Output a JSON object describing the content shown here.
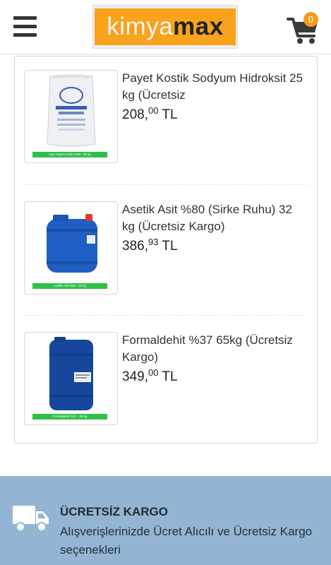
{
  "header": {
    "menu_icon": "hamburger-menu-icon",
    "logo_part1": "kimya",
    "logo_part2": "max",
    "cart_icon": "shopping-cart-icon",
    "cart_count": "0"
  },
  "products": [
    {
      "name": "Payet Kostik Sodyum Hidroksit 25 kg (Ücretsiz",
      "price_int": "208,",
      "price_dec": "00",
      "currency": " TL",
      "image_label": "Caustic soda flakes bag",
      "image_band": "Can Payet Kostik %99 - 25 kg"
    },
    {
      "name": "Asetik Asit %80 (Sirke Ruhu) 32 kg (Ücretsiz Kargo)",
      "price_int": "386,",
      "price_dec": "93",
      "currency": " TL",
      "image_label": "Blue drum with red cap",
      "image_band": "Asetik Asit %80 - 32 kg"
    },
    {
      "name": "Formaldehit %37 65kg (Ücretsiz Kargo)",
      "price_int": "349,",
      "price_dec": "00",
      "currency": " TL",
      "image_label": "Tall blue drum",
      "image_band": "Formaldehit %37 - 65 kg"
    }
  ],
  "shipping": {
    "icon": "truck-icon",
    "title": "ÜCRETSİZ KARGO",
    "description": "Alışverişlerinizde Ücret Alıcılı ve Ücretsiz Kargo seçenekleri"
  },
  "colors": {
    "accent": "#f9a21b",
    "footer_band": "#94b4d3",
    "band_green": "#2fc04a"
  }
}
